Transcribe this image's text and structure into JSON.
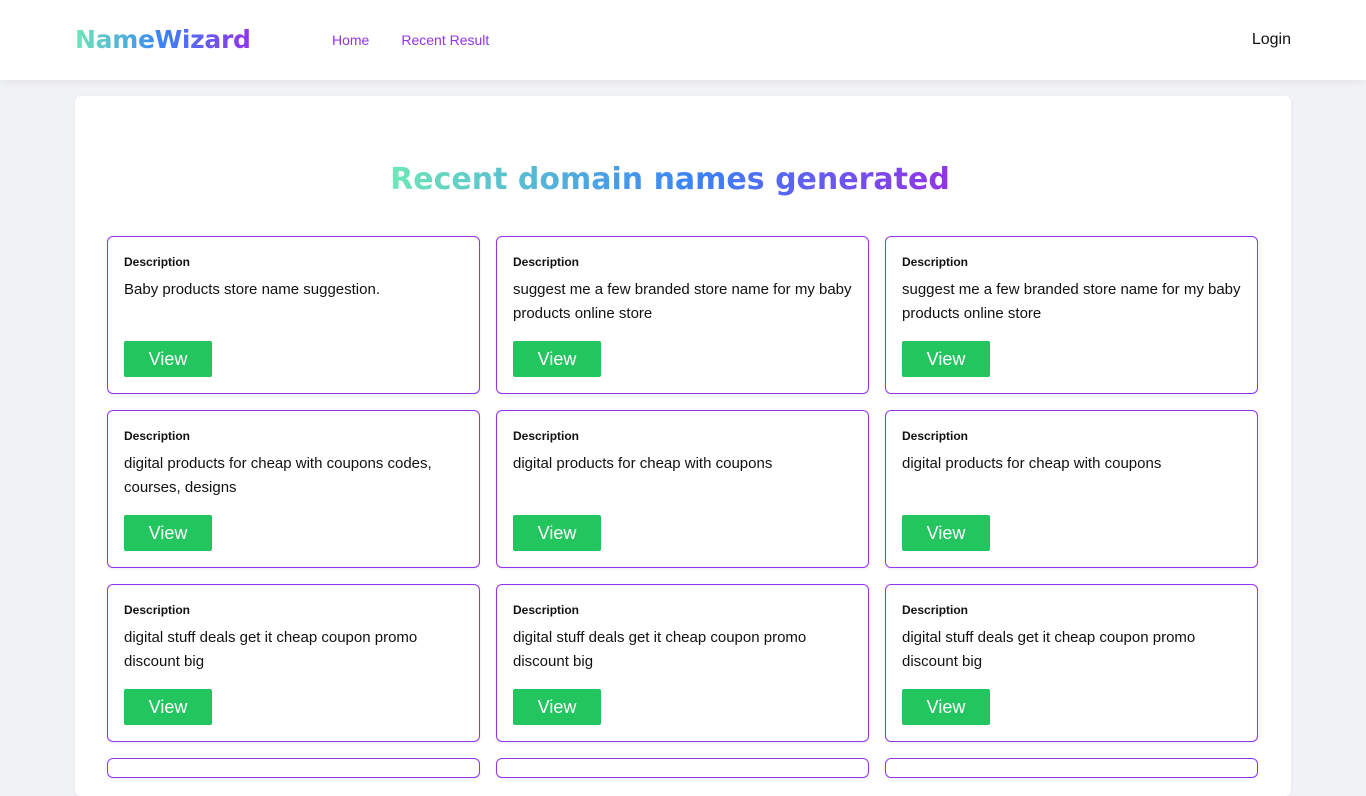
{
  "nav": {
    "logo": "NameWizard",
    "links": [
      "Home",
      "Recent Result"
    ],
    "login": "Login"
  },
  "main": {
    "title": "Recent domain names generated",
    "description_label": "Description",
    "view_label": "View",
    "results": [
      {
        "description": "Baby products store name suggestion."
      },
      {
        "description": "suggest me a few branded store name for my baby products online store"
      },
      {
        "description": "suggest me a few branded store name for my baby products online store"
      },
      {
        "description": "digital products for cheap with coupons codes, courses, designs"
      },
      {
        "description": "digital products for cheap with coupons"
      },
      {
        "description": "digital products for cheap with coupons"
      },
      {
        "description": "digital stuff deals get it cheap coupon promo discount big"
      },
      {
        "description": "digital stuff deals get it cheap coupon promo discount big"
      },
      {
        "description": "digital stuff deals get it cheap coupon promo discount big"
      }
    ]
  },
  "colors": {
    "accent_purple": "#9333ea",
    "button_green": "#22c55e",
    "gradient_start": "#6ee7b7",
    "gradient_mid": "#3b82f6",
    "gradient_end": "#9333ea",
    "page_background": "#f1f2f5"
  }
}
